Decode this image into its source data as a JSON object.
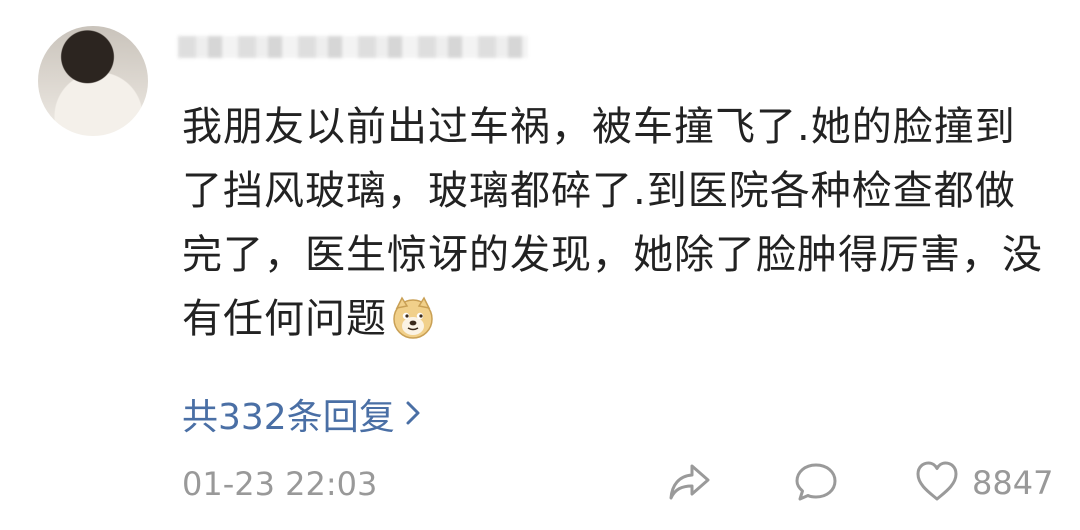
{
  "comment": {
    "username": "",
    "text": "我朋友以前出过车祸，被车撞飞了.她的脸撞到了挡风玻璃，玻璃都碎了.到医院各种检查都做完了，医生惊讶的发现，她除了脸肿得厉害，没有任何问题",
    "emoji_icon": "doge-icon",
    "replies_label": "共332条回复",
    "timestamp": "01-23 22:03",
    "like_count": "8847"
  },
  "colors": {
    "text": "#222222",
    "link": "#4a6fa5",
    "meta": "#999999"
  },
  "icons": {
    "share": "share-icon",
    "comment": "comment-bubble-icon",
    "like": "heart-icon",
    "replies": "chevron-right-icon"
  }
}
